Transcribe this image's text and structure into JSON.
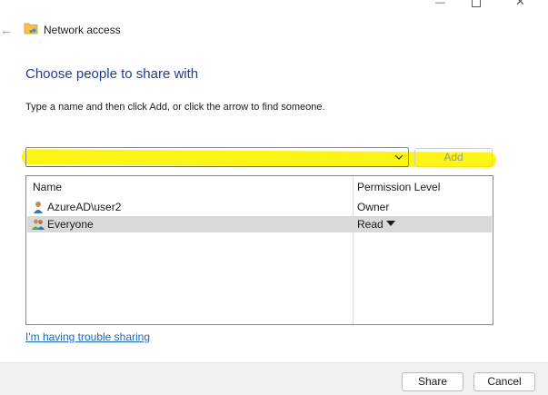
{
  "window": {
    "title": "Network access",
    "minimize_glyph": "—",
    "close_glyph": "✕",
    "back_glyph": "←"
  },
  "page": {
    "heading": "Choose people to share with",
    "instruction": "Type a name and then click Add, or click the arrow to find someone."
  },
  "name_input": {
    "value": "",
    "placeholder": ""
  },
  "add_label": "Add",
  "list": {
    "headers": [
      "Name",
      "Permission Level"
    ],
    "rows": [
      {
        "name": "AzureAD\\user2",
        "permission": "Owner",
        "icon": "user-icon"
      },
      {
        "name": "Everyone",
        "permission": "Read",
        "icon": "group-icon",
        "selected": true
      }
    ]
  },
  "trouble_link": "I'm having trouble sharing",
  "footer": {
    "share_label": "Share",
    "cancel_label": "Cancel"
  },
  "colors": {
    "heading": "#1e3d8f",
    "link": "#1a66b8",
    "highlight": "#fbf414",
    "selected_row": "#d9d9d9"
  }
}
